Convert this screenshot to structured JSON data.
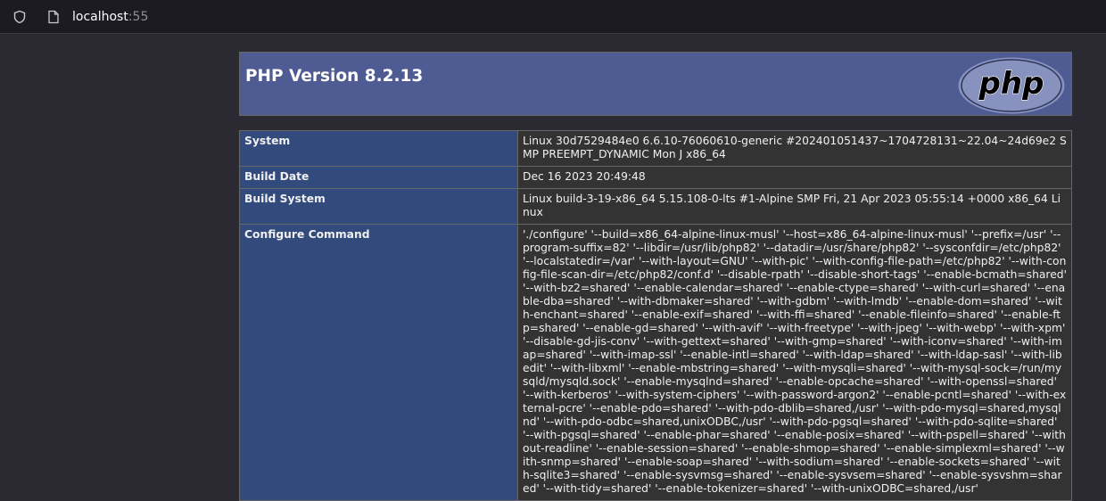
{
  "browser": {
    "url_host": "localhost",
    "url_port": ":55"
  },
  "header": {
    "title": "PHP Version 8.2.13",
    "logo_text": "php"
  },
  "rows": [
    {
      "label": "System",
      "value": "Linux 30d7529484e0 6.6.10-76060610-generic #202401051437~1704728131~22.04~24d69e2 SMP PREEMPT_DYNAMIC Mon J x86_64"
    },
    {
      "label": "Build Date",
      "value": "Dec 16 2023 20:49:48"
    },
    {
      "label": "Build System",
      "value": "Linux build-3-19-x86_64 5.15.108-0-lts #1-Alpine SMP Fri, 21 Apr 2023 05:55:14 +0000 x86_64 Linux"
    },
    {
      "label": "Configure Command",
      "value": "'./configure' '--build=x86_64-alpine-linux-musl' '--host=x86_64-alpine-linux-musl' '--prefix=/usr' '--program-suffix=82' '--libdir=/usr/lib/php82' '--datadir=/usr/share/php82' '--sysconfdir=/etc/php82' '--localstatedir=/var' '--with-layout=GNU' '--with-pic' '--with-config-file-path=/etc/php82' '--with-config-file-scan-dir=/etc/php82/conf.d' '--disable-rpath' '--disable-short-tags' '--enable-bcmath=shared' '--with-bz2=shared' '--enable-calendar=shared' '--enable-ctype=shared' '--with-curl=shared' '--enable-dba=shared' '--with-dbmaker=shared' '--with-gdbm' '--with-lmdb' '--enable-dom=shared' '--with-enchant=shared' '--enable-exif=shared' '--with-ffi=shared' '--enable-fileinfo=shared' '--enable-ftp=shared' '--enable-gd=shared' '--with-avif' '--with-freetype' '--with-jpeg' '--with-webp' '--with-xpm' '--disable-gd-jis-conv' '--with-gettext=shared' '--with-gmp=shared' '--with-iconv=shared' '--with-imap=shared' '--with-imap-ssl' '--enable-intl=shared' '--with-ldap=shared' '--with-ldap-sasl' '--with-libedit' '--with-libxml' '--enable-mbstring=shared' '--with-mysqli=shared' '--with-mysql-sock=/run/mysqld/mysqld.sock' '--enable-mysqlnd=shared' '--enable-opcache=shared' '--with-openssl=shared' '--with-kerberos' '--with-system-ciphers' '--with-password-argon2' '--enable-pcntl=shared' '--with-external-pcre' '--enable-pdo=shared' '--with-pdo-dblib=shared,/usr' '--with-pdo-mysql=shared,mysqlnd' '--with-pdo-odbc=shared,unixODBC,/usr' '--with-pdo-pgsql=shared' '--with-pdo-sqlite=shared' '--with-pgsql=shared' '--enable-phar=shared' '--enable-posix=shared' '--with-pspell=shared' '--without-readline' '--enable-session=shared' '--enable-shmop=shared' '--enable-simplexml=shared' '--with-snmp=shared' '--enable-soap=shared' '--with-sodium=shared' '--enable-sockets=shared' '--with-sqlite3=shared' '--enable-sysvmsg=shared' '--enable-sysvsem=shared' '--enable-sysvshm=shared' '--with-tidy=shared' '--enable-tokenizer=shared' '--with-unixODBC=shared,/usr'"
    }
  ]
}
